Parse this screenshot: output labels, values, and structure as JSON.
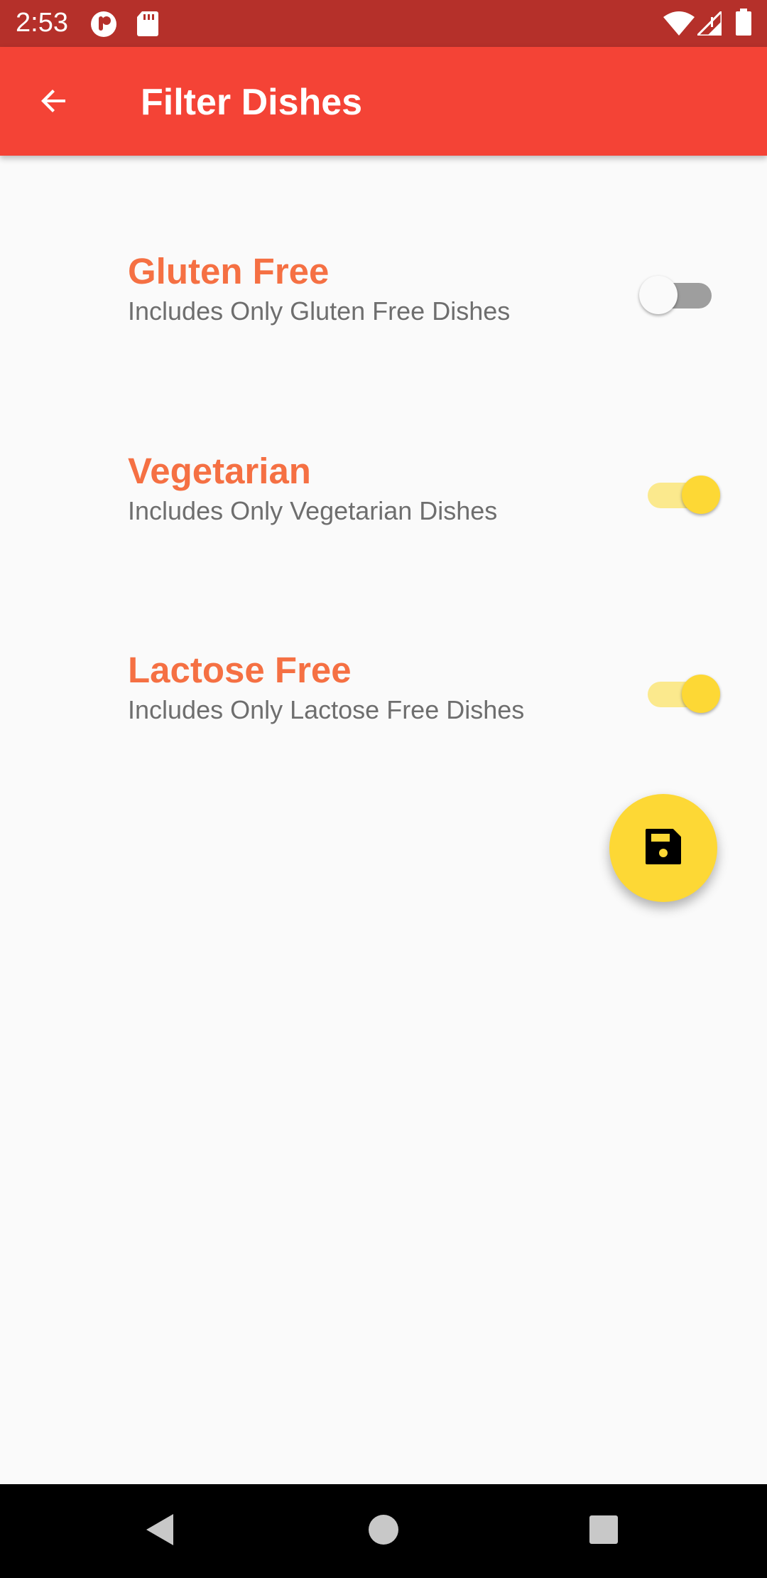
{
  "status_bar": {
    "time": "2:53",
    "icons": [
      "notification-app-icon",
      "sd-card-icon",
      "wifi-icon",
      "signal-icon",
      "battery-icon"
    ]
  },
  "app_bar": {
    "title": "Filter Dishes",
    "back_icon": "arrow-back-icon",
    "background": "#f44336"
  },
  "filters": [
    {
      "title": "Gluten Free",
      "subtitle": "Includes Only Gluten Free Dishes",
      "enabled": false
    },
    {
      "title": "Vegetarian",
      "subtitle": "Includes Only Vegetarian Dishes",
      "enabled": true
    },
    {
      "title": "Lactose Free",
      "subtitle": "Includes Only Lactose Free Dishes",
      "enabled": true
    }
  ],
  "fab": {
    "icon": "save-icon",
    "color": "#fdd835"
  },
  "colors": {
    "accent": "#fdd835",
    "title_text": "#f57043",
    "status_bar": "#b5302a"
  },
  "nav_bar": {
    "buttons": [
      "back-triangle-icon",
      "home-circle-icon",
      "recents-square-icon"
    ]
  }
}
